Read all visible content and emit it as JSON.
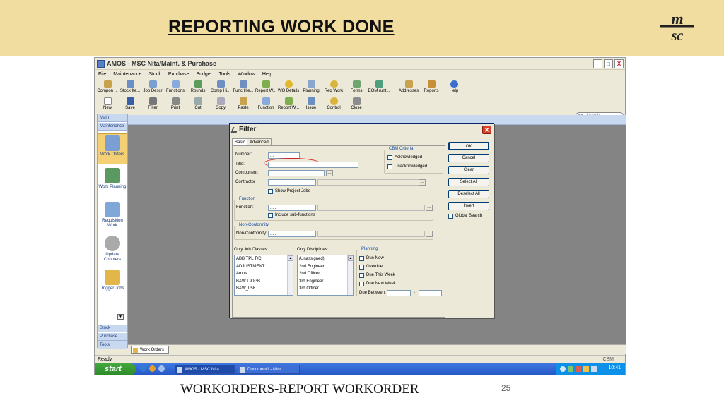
{
  "slide": {
    "title": "REPORTING WORK DONE",
    "logo_text": "msc",
    "caption": "WORKORDERS-REPORT WORKORDER",
    "page_number": "25"
  },
  "app": {
    "title": "AMOS - MSC Nita/Maint. & Purchase",
    "window_buttons": [
      "_",
      "□",
      "X"
    ],
    "menu": [
      "File",
      "Maintenance",
      "Stock",
      "Purchase",
      "Budget",
      "Tools",
      "Window",
      "Help"
    ],
    "toolbar1": [
      "Compon ...",
      "Stock Ite...",
      "Job Descr",
      "Functions",
      "Rounds",
      "Comp Hi...",
      "Func Hie...",
      "Report W...",
      "WO Details",
      "Planning",
      "Req Work",
      "Forms",
      "EOM runt...",
      "Addresses",
      "Reports",
      "Help"
    ],
    "toolbar2": [
      "New",
      "Save",
      "Filter",
      "Print",
      "Cut",
      "Copy",
      "Paste",
      "Function",
      "Report W...",
      "Issue",
      "Control",
      "Close"
    ],
    "search_placeholder": "Search",
    "sidebar": {
      "headers_top": [
        "Main",
        "Maintenance"
      ],
      "items": [
        "Work Orders",
        "Work Planning",
        "Requisition Work",
        "Update Counters",
        "Trigger Jobs"
      ],
      "headers_bottom": [
        "Stock",
        "Purchase",
        "Tools"
      ]
    },
    "doc_tab": "Work Orders",
    "status_left": "Ready",
    "status_right": "CBM",
    "taskbar": {
      "start": "start",
      "tasks": [
        "AMOS - MSC Nita...",
        "Document1 - Micr..."
      ],
      "clock": "10:41"
    }
  },
  "filter": {
    "title": "Filter",
    "tabs": [
      "Basic",
      "Advanced"
    ],
    "labels": {
      "number": "Number:",
      "title": "Title:",
      "component": "Component:",
      "contractor": "Contractor",
      "show_project_jobs": "Show Project Jobs",
      "function_group": "Function",
      "function": "Function:",
      "include_sub": "Include sub-functions",
      "nonconf_group": "Non-Conformity",
      "nonconf": "Non-Conformity:",
      "cbm_group": "CBM Criteria",
      "acknowledged": "Acknowledged",
      "unacknowledged": "Unacknowledged",
      "only_job_classes": "Only Job Classes:",
      "only_disciplines": "Only Disciplines:",
      "planning_group": "Planning",
      "due_now": "Due Now",
      "overdue": "Overdue",
      "due_this_week": "Due This Week",
      "due_next_week": "Due Next Week",
      "due_between": "Due Between:",
      "dash": "-"
    },
    "values": {
      "number": "  .   .",
      "component": ". . .",
      "function": ". . .",
      "nonconf": ". . ."
    },
    "job_classes": [
      "ABB TPL T/C",
      "ADJUSTMENT",
      "Amos",
      "B&W L90GB",
      "B&W_L58"
    ],
    "disciplines": [
      "(Unassigned)",
      "2nd Engineer",
      "2nd Officer",
      "3rd Engineer",
      "3rd Officer"
    ],
    "buttons": [
      "OK",
      "Cancel",
      "Clear",
      "Select All",
      "Deselect All",
      "Invert"
    ],
    "global_search": "Global Search"
  },
  "colors": {
    "banner": "#f2dda0",
    "highlight_oval": "#d21f1f",
    "taskbar": "#2456c4",
    "start_button": "#2d8a28"
  }
}
